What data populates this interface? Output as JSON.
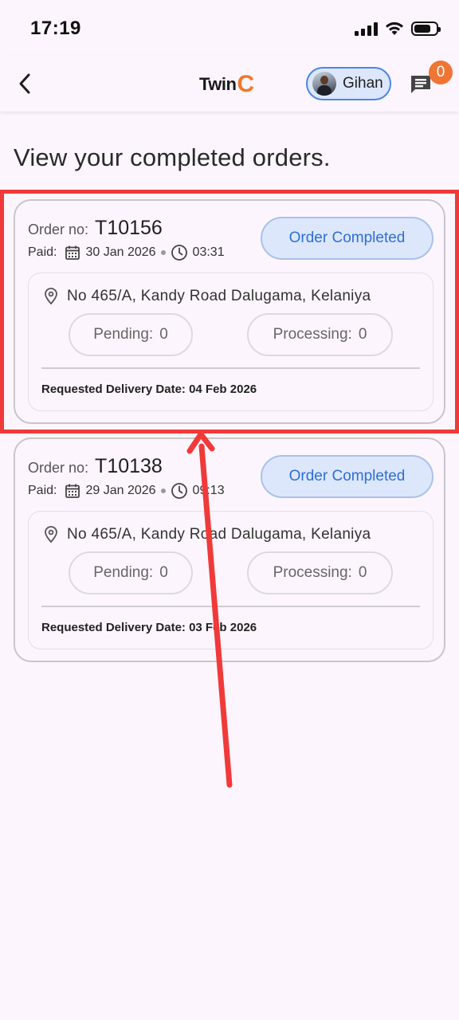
{
  "status_bar": {
    "time": "17:19"
  },
  "header": {
    "logo_text": "Twin",
    "logo_accent": "C",
    "user_name": "Gihan",
    "message_count": "0"
  },
  "page": {
    "title": "View your completed orders."
  },
  "orders": [
    {
      "order_no_label": "Order no:",
      "order_no": "T10156",
      "paid_label": "Paid:",
      "date": "30 Jan 2026",
      "time": "03:31",
      "status": "Order Completed",
      "address": "No 465/A, Kandy Road Dalugama, Kelaniya",
      "pending_label": "Pending:",
      "pending_count": "0",
      "processing_label": "Processing:",
      "processing_count": "0",
      "delivery": "Requested Delivery Date: 04 Feb 2026"
    },
    {
      "order_no_label": "Order no:",
      "order_no": "T10138",
      "paid_label": "Paid:",
      "date": "29 Jan 2026",
      "time": "09:13",
      "status": "Order Completed",
      "address": "No 465/A, Kandy Road Dalugama, Kelaniya",
      "pending_label": "Pending:",
      "pending_count": "0",
      "processing_label": "Processing:",
      "processing_count": "0",
      "delivery": "Requested Delivery Date: 03 Feb 2026"
    }
  ],
  "colors": {
    "background": "#fcf5fd",
    "accent_blue": "#2e6ed8",
    "status_pill_bg": "#dce7fb",
    "badge_orange": "#ee7534",
    "annotation_red": "#f03a3a"
  },
  "icons": [
    "back-arrow-icon",
    "message-icon",
    "calendar-icon",
    "clock-icon",
    "location-pin-icon",
    "signal-icon",
    "wifi-icon",
    "battery-icon"
  ]
}
